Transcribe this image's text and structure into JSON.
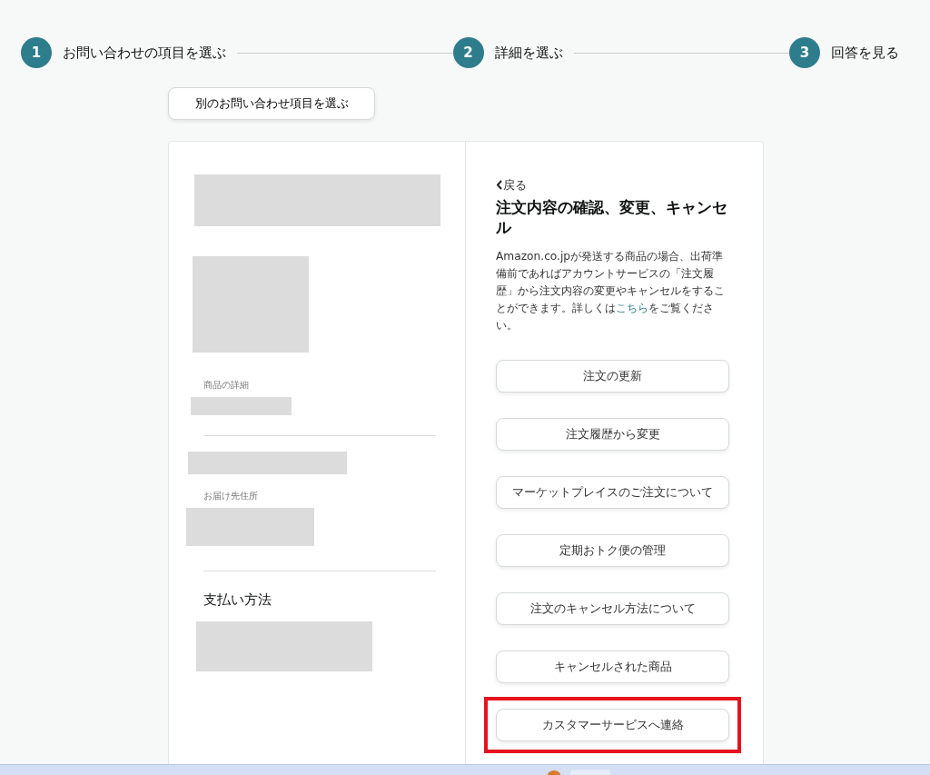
{
  "steps": [
    {
      "number": "1",
      "label": "お問い合わせの項目を選ぶ"
    },
    {
      "number": "2",
      "label": "詳細を選ぶ"
    },
    {
      "number": "3",
      "label": "回答を見る"
    }
  ],
  "change_topic_button": "別のお問い合わせ項目を選ぶ",
  "left_panel": {
    "product_details_label": "商品の詳細",
    "address_label": "お届け先住所",
    "payment_heading": "支払い方法"
  },
  "right_panel": {
    "back_link": "戻る",
    "title": "注文内容の確認、変更、キャンセル",
    "description": {
      "before": "Amazon.co.jpが発送する商品の場合、出荷準備前であればアカウントサービスの「注文履歴」から注文内容の変更やキャンセルをすることができます。詳しくは",
      "link": "こちら",
      "after": "をご覧ください。"
    },
    "options": [
      {
        "label": "注文の更新",
        "highlighted": false
      },
      {
        "label": "注文履歴から変更",
        "highlighted": false
      },
      {
        "label": "マーケットプレイスのご注文について",
        "highlighted": false
      },
      {
        "label": "定期おトク便の管理",
        "highlighted": false
      },
      {
        "label": "注文のキャンセル方法について",
        "highlighted": false
      },
      {
        "label": "キャンセルされた商品",
        "highlighted": false
      },
      {
        "label": "カスタマーサービスへ連絡",
        "highlighted": true
      }
    ]
  }
}
